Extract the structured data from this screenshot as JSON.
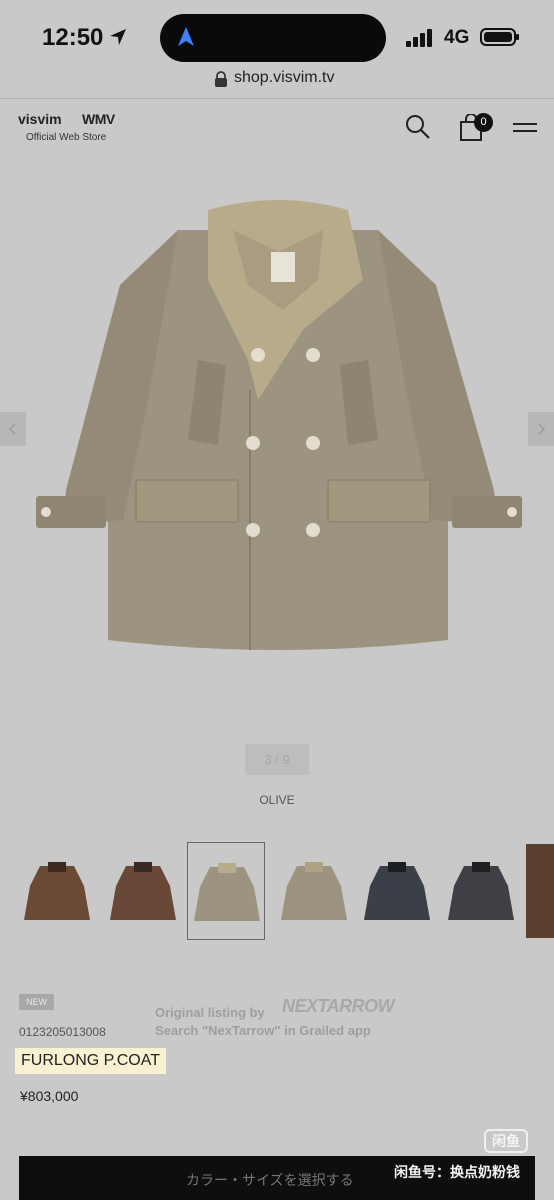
{
  "status_bar": {
    "time": "12:50",
    "network": "4G",
    "icons": [
      "location-arrow-icon",
      "dynamic-island-navigation-icon",
      "signal-bars-icon",
      "battery-icon"
    ]
  },
  "browser": {
    "url": "shop.visvim.tv"
  },
  "header": {
    "brand": "visvim",
    "brand_secondary": "WMV",
    "subtitle": "Official Web Store",
    "cart_count": "0",
    "icons": [
      "search-icon",
      "shopping-bag-icon",
      "hamburger-menu-icon"
    ]
  },
  "gallery": {
    "pager": "3 / 9",
    "color": "OLIVE",
    "thumbnails": [
      {
        "color": "#6b4a35"
      },
      {
        "color": "#6a4838"
      },
      {
        "color": "#9c9380",
        "selected": true
      },
      {
        "color": "#9c9280"
      },
      {
        "color": "#3b3f47"
      },
      {
        "color": "#3e4046"
      },
      {
        "color": "#5a3f2c"
      }
    ]
  },
  "product": {
    "badge": "NEW",
    "sku": "0123205013008",
    "name": "FURLONG P.COAT",
    "price": "¥803,000"
  },
  "watermark": {
    "text": "Original listing by",
    "logo": "NEXTARROW",
    "subtext": "Search \"NexTarrow\" in Grailed app"
  },
  "overlay": {
    "app_logo": "闲鱼",
    "seller_id": "闲鱼号：换点奶粉钱"
  },
  "bottom_bar": {
    "label": "カラー・サイズを選択する"
  },
  "colors": {
    "background": "#c9c9c9",
    "coat": "#9c9380",
    "collar": "#b8ab8a",
    "bottom_bar": "#0e0e0e"
  }
}
